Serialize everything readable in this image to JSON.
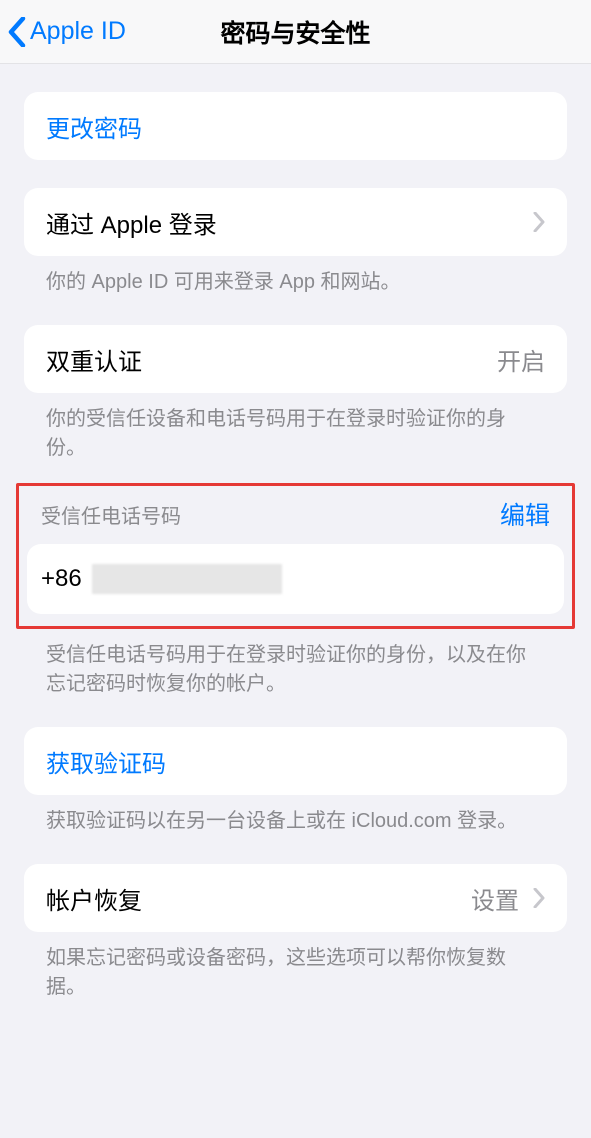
{
  "nav": {
    "back_label": "Apple ID",
    "title": "密码与安全性"
  },
  "change_password": {
    "label": "更改密码"
  },
  "signin_with_apple": {
    "label": "通过 Apple 登录",
    "footer": "你的 Apple ID 可用来登录 App 和网站。"
  },
  "two_factor": {
    "label": "双重认证",
    "status": "开启",
    "footer": "你的受信任设备和电话号码用于在登录时验证你的身份。"
  },
  "trusted_phone": {
    "header": "受信任电话号码",
    "edit": "编辑",
    "phone_prefix": "+86",
    "footer": "受信任电话号码用于在登录时验证你的身份，以及在你忘记密码时恢复你的帐户。"
  },
  "get_code": {
    "label": "获取验证码",
    "footer": "获取验证码以在另一台设备上或在 iCloud.com 登录。"
  },
  "account_recovery": {
    "label": "帐户恢复",
    "value": "设置",
    "footer": "如果忘记密码或设备密码，这些选项可以帮你恢复数据。"
  }
}
